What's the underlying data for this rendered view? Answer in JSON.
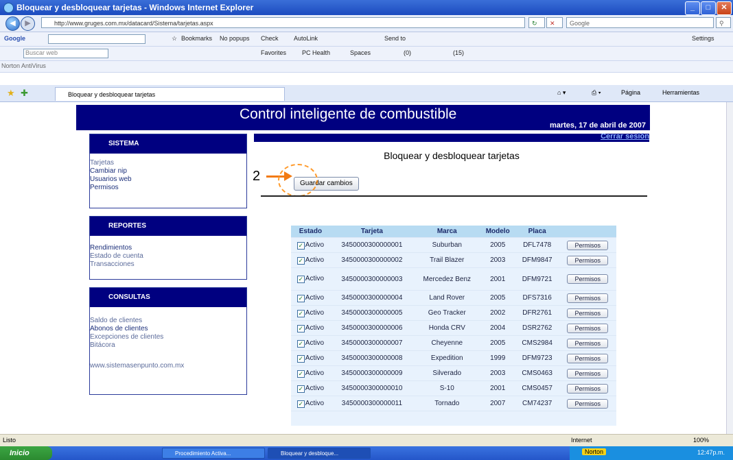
{
  "window": {
    "title": "Bloquear y desbloquear tarjetas - Windows Internet Explorer",
    "url": "http://www.gruges.com.mx/datacard/Sistema/tarjetas.aspx",
    "search_placeholder": "Google",
    "tab_label": "Bloquear y desbloquear tarjetas",
    "pagina_menu": "Página",
    "herramientas_menu": "Herramientas",
    "settings": "Settings"
  },
  "toolbars": {
    "google_label": "Google",
    "search_web_placeholder": "Buscar web",
    "bookmarks": "Bookmarks",
    "no_popups": "No popups",
    "check": "Check",
    "autolink": "AutoLink",
    "send_to": "Send to",
    "favorites": "Favorites",
    "pc_health": "PC Health",
    "spaces": "Spaces",
    "count_1": "(0)",
    "count_2": "(15)",
    "norton_label": "Norton AntiVirus"
  },
  "header": {
    "app_title": "Control inteligente de combustible",
    "date": "martes, 17 de abril de 2007",
    "logout": "Cerrar sesión"
  },
  "sidebar": {
    "sistema": {
      "title": "SISTEMA",
      "items": [
        "Tarjetas",
        "Cambiar nip",
        "Usuarios web",
        "Permisos"
      ]
    },
    "reportes": {
      "title": "REPORTES",
      "items": [
        "Rendimientos",
        "Estado de cuenta",
        "Transacciones"
      ]
    },
    "consultas": {
      "title": "CONSULTAS",
      "items": [
        "Saldo de clientes",
        "Abonos de clientes",
        "Excepciones de clientes",
        "Bitácora"
      ],
      "footer": "www.sistemasenpunto.com.mx"
    }
  },
  "main": {
    "page_title": "Bloquear y desbloquear tarjetas",
    "save_button": "Guardar cambios",
    "annotation_number": "2"
  },
  "table": {
    "headers": [
      "Estado",
      "Tarjeta",
      "Marca",
      "Modelo",
      "Placa"
    ],
    "check_mark": "✓",
    "rows": [
      {
        "estado": "Activo",
        "tarjeta": "3450000300000001",
        "marca": "Suburban",
        "modelo": "2005",
        "placa": "DFL7478",
        "action": "Permisos"
      },
      {
        "estado": "Activo",
        "tarjeta": "3450000300000002",
        "marca": "Trail Blazer",
        "modelo": "2003",
        "placa": "DFM9847",
        "action": "Permisos"
      },
      {
        "estado": "Activo",
        "tarjeta": "3450000300000003",
        "marca": "Mercedez Benz",
        "modelo": "2001",
        "placa": "DFM9721",
        "action": "Permisos"
      },
      {
        "estado": "Activo",
        "tarjeta": "3450000300000004",
        "marca": "Land Rover",
        "modelo": "2005",
        "placa": "DFS7316",
        "action": "Permisos"
      },
      {
        "estado": "Activo",
        "tarjeta": "3450000300000005",
        "marca": "Geo Tracker",
        "modelo": "2002",
        "placa": "DFR2761",
        "action": "Permisos"
      },
      {
        "estado": "Activo",
        "tarjeta": "3450000300000006",
        "marca": "Honda CRV",
        "modelo": "2004",
        "placa": "DSR2762",
        "action": "Permisos"
      },
      {
        "estado": "Activo",
        "tarjeta": "3450000300000007",
        "marca": "Cheyenne",
        "modelo": "2005",
        "placa": "CMS2984",
        "action": "Permisos"
      },
      {
        "estado": "Activo",
        "tarjeta": "3450000300000008",
        "marca": "Expedition",
        "modelo": "1999",
        "placa": "DFM9723",
        "action": "Permisos"
      },
      {
        "estado": "Activo",
        "tarjeta": "3450000300000009",
        "marca": "Silverado",
        "modelo": "2003",
        "placa": "CMS0463",
        "action": "Permisos"
      },
      {
        "estado": "Activo",
        "tarjeta": "3450000300000010",
        "marca": "S-10",
        "modelo": "2001",
        "placa": "CMS0457",
        "action": "Permisos"
      },
      {
        "estado": "Activo",
        "tarjeta": "3450000300000011",
        "marca": "Tornado",
        "modelo": "2007",
        "placa": "CM74237",
        "action": "Permisos"
      }
    ]
  },
  "statusbar": {
    "left": "Listo",
    "zone": "Internet",
    "zoom": "100%"
  },
  "taskbar": {
    "start": "Inicio",
    "items": [
      "Procedimiento Activa...",
      "Bloquear y desbloque..."
    ],
    "norton": "Norton",
    "clock": "12:47p.m."
  }
}
